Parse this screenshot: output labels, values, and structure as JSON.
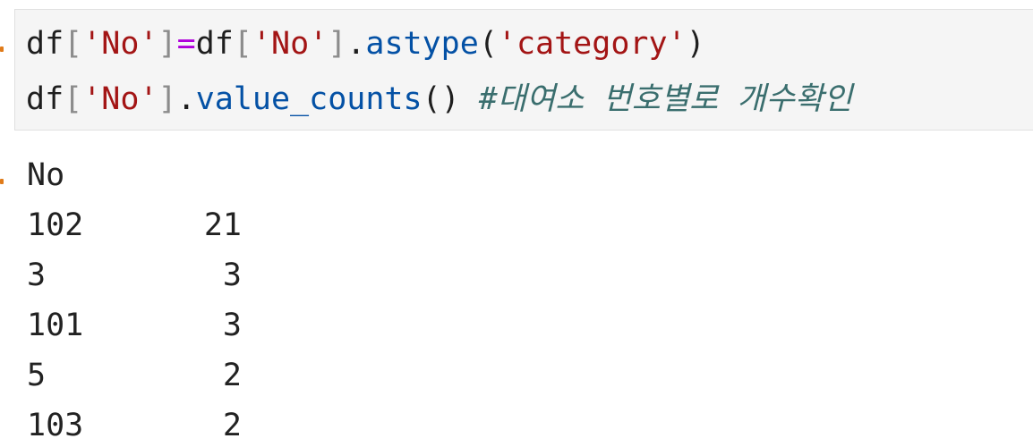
{
  "cell": {
    "code": {
      "line1": {
        "var1": "df",
        "br1": "[",
        "str1": "'No'",
        "br2": "]",
        "op": "=",
        "var2": "df",
        "br3": "[",
        "str2": "'No'",
        "br4": "]",
        "dot": ".",
        "method": "astype",
        "paren_open": "(",
        "arg": "'category'",
        "paren_close": ")"
      },
      "line2": {
        "var": "df",
        "br1": "[",
        "str": "'No'",
        "br2": "]",
        "dot": ".",
        "method": "value_counts",
        "parens": "()",
        "comment": "#대여소 번호별로 개수확인"
      }
    },
    "output": {
      "header": "No",
      "rows": [
        {
          "key": "102",
          "value": "21"
        },
        {
          "key": "3",
          "value": "3"
        },
        {
          "key": "101",
          "value": "3"
        },
        {
          "key": "5",
          "value": "2"
        },
        {
          "key": "103",
          "value": "2"
        }
      ]
    }
  },
  "colors": {
    "marker": "#e07b1a",
    "string": "#a31515",
    "method": "#0451a5",
    "operator": "#af00db",
    "comment": "#3a6e6e",
    "cell_background": "#f5f5f5"
  }
}
